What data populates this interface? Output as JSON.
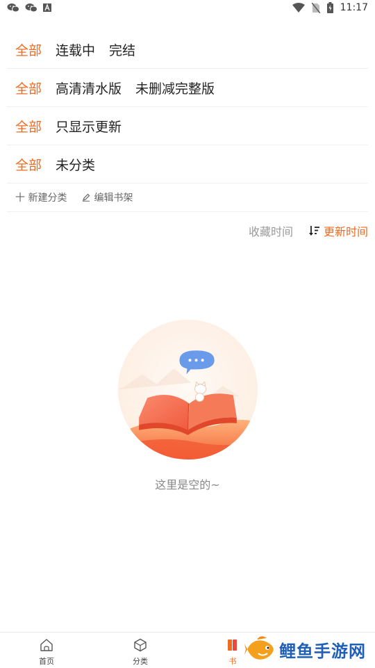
{
  "status_bar": {
    "time": "11:17",
    "icons": [
      "wechat-icon",
      "wechat-icon",
      "app-icon",
      "wifi-icon",
      "no-sim-icon",
      "battery-charging-icon"
    ]
  },
  "filters": {
    "rows": [
      {
        "active": "全部",
        "options": [
          "连载中",
          "完结"
        ]
      },
      {
        "active": "全部",
        "options": [
          "高清清水版",
          "未删减完整版"
        ]
      },
      {
        "active": "全部",
        "options": [
          "只显示更新"
        ]
      },
      {
        "active": "全部",
        "options": [
          "未分类"
        ]
      }
    ],
    "new_category": "十 新建分类",
    "edit_shelf": "编辑书架"
  },
  "sort": {
    "collect_time": "收藏时间",
    "update_time": "更新时间"
  },
  "empty": {
    "text": "这里是空的~"
  },
  "bottom_nav": {
    "home": "首页",
    "category": "分类",
    "shelf": "书"
  },
  "watermark": {
    "text": "鲤鱼手游网"
  },
  "colors": {
    "accent": "#f06a1f",
    "text": "#222222",
    "muted": "#9a9a9a",
    "divider": "#efefef",
    "watermark_blue": "#1f5fb5"
  }
}
